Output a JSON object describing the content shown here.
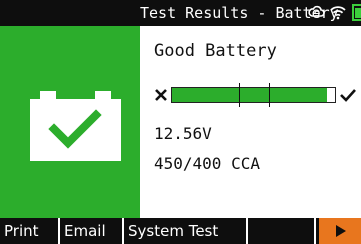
{
  "status_bar": {
    "title": "Test Results - Battery",
    "icons": [
      "cloud-sync-icon",
      "wifi-icon",
      "battery-level-icon"
    ]
  },
  "result": {
    "title": "Good Battery",
    "icon": "battery-check-icon",
    "status_color": "#2cad2c",
    "gauge": {
      "fill_fraction": 0.95,
      "fail_icon": "x-icon",
      "pass_icon": "check-icon"
    },
    "voltage": "12.56V",
    "cca": "450/400 CCA"
  },
  "softkeys": {
    "print_label": "Print",
    "email_label": "Email",
    "system_test_label": "System Test",
    "blank_label": "",
    "next_icon": "play-right-icon",
    "next_color": "#e8761e"
  }
}
